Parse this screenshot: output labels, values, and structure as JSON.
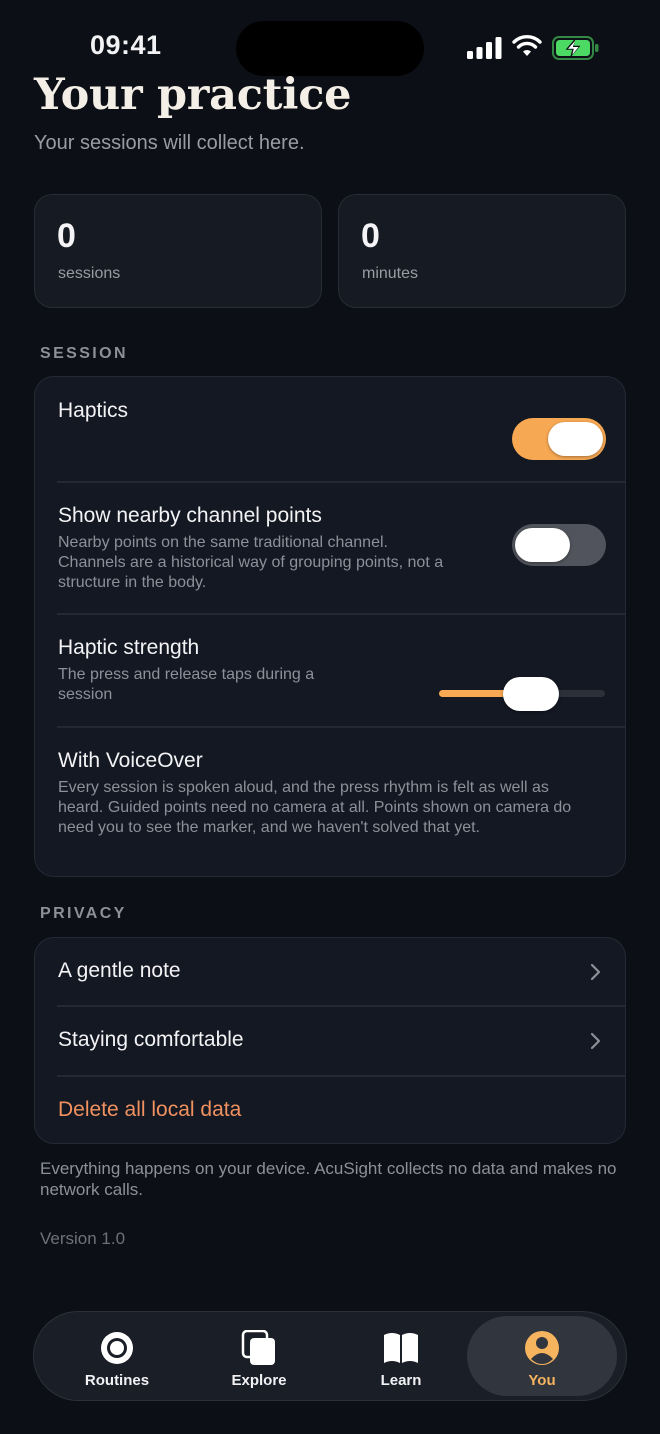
{
  "status_bar": {
    "time": "09:41"
  },
  "header": {
    "title": "Your practice",
    "subtitle": "Your sessions will collect here."
  },
  "stats": [
    {
      "value": "0",
      "label": "sessions"
    },
    {
      "value": "0",
      "label": "minutes"
    }
  ],
  "session": {
    "header": "SESSION",
    "haptics": {
      "title": "Haptics",
      "enabled": true
    },
    "nearby": {
      "title": "Show nearby channel points",
      "subtitle": "Nearby points on the same traditional channel. Channels are a historical way of grouping points, not a structure in the body.",
      "enabled": false
    },
    "strength": {
      "title": "Haptic strength",
      "subtitle": "The press and release taps during a session",
      "value": 0.58
    },
    "voiceover": {
      "title": "With VoiceOver",
      "subtitle": "Every session is spoken aloud, and the press rhythm is felt as well as heard. Guided points need no camera at all. Points shown on camera do need you to see the marker, and we haven't solved that yet."
    }
  },
  "privacy": {
    "header": "PRIVACY",
    "items": [
      {
        "label": "A gentle note"
      },
      {
        "label": "Staying comfortable"
      }
    ],
    "delete_label": "Delete all local data"
  },
  "footer": {
    "note": "Everything happens on your device. AcuSight collects no data and makes no network calls.",
    "version": "Version 1.0"
  },
  "tabs": [
    {
      "label": "Routines",
      "icon": "target-icon",
      "active": false
    },
    {
      "label": "Explore",
      "icon": "cards-icon",
      "active": false
    },
    {
      "label": "Learn",
      "icon": "book-icon",
      "active": false
    },
    {
      "label": "You",
      "icon": "person-icon",
      "active": true
    }
  ],
  "colors": {
    "accent": "#f7a853",
    "danger": "#f0915f",
    "background": "#0c0f15",
    "card": "#141822"
  }
}
